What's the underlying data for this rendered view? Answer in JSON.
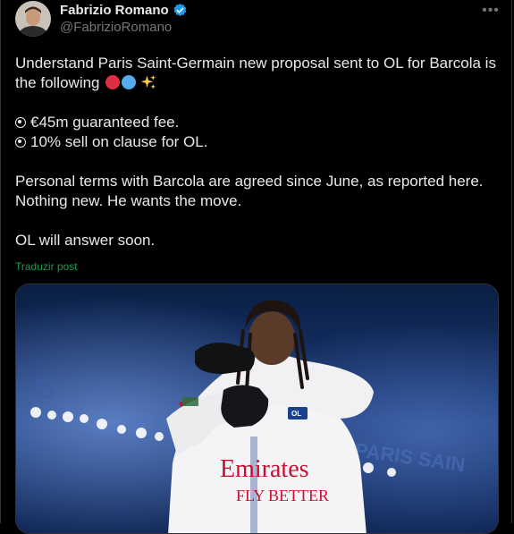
{
  "author": {
    "display_name": "Fabrizio Romano",
    "handle": "@FabrizioRomano"
  },
  "tweet": {
    "line1": "Understand Paris Saint-Germain new proposal sent to OL for Barcola is",
    "line2": "the following",
    "emojis": [
      "red-circle",
      "blue-circle",
      "sparkles"
    ],
    "bullet1": "€45m guaranteed fee.",
    "bullet2": "10% sell on clause for OL.",
    "para2_line1": "Personal terms with Barcola are agreed since June, as reported here.",
    "para2_line2": "Nothing new. He wants the move.",
    "para3": "OL will answer soon."
  },
  "translate_label": "Traduzir post",
  "media": {
    "shirt_sponsor_line1": "Emirates",
    "shirt_sponsor_line2": "FLY BETTER",
    "background_text_left": "S",
    "background_text_right": "PARIS SAIN"
  },
  "colors": {
    "verified": "#1d9bf0",
    "translate": "#1d9b50",
    "background": "#000000",
    "text": "#e7e9ea",
    "muted": "#71767b"
  }
}
